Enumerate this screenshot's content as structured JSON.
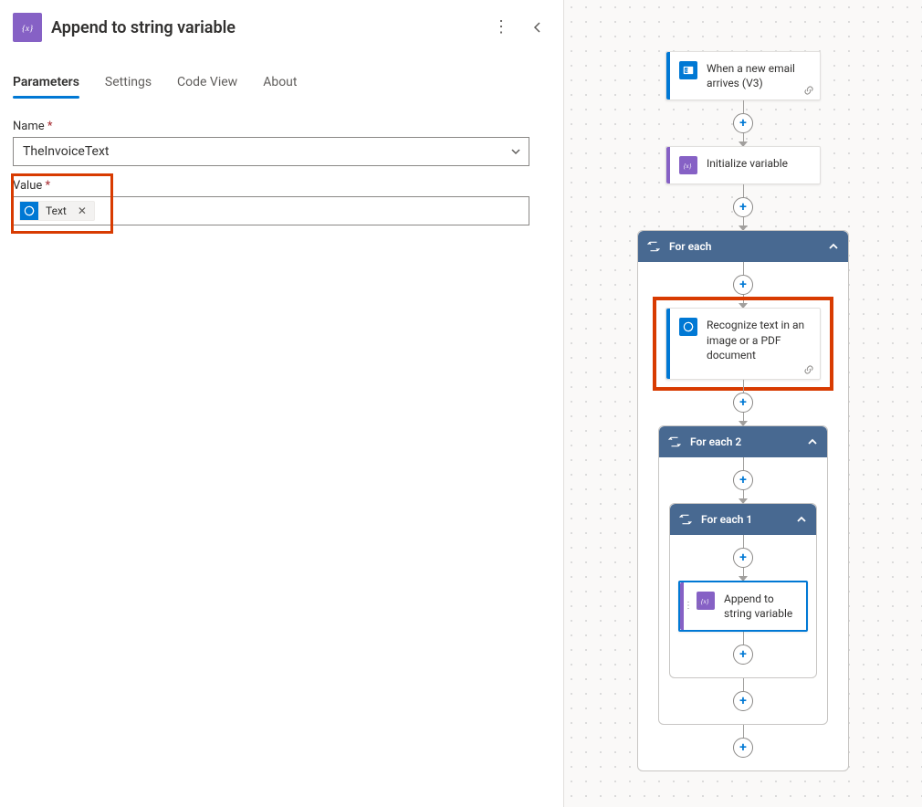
{
  "panel": {
    "title": "Append to string variable",
    "tabs": {
      "parameters": "Parameters",
      "settings": "Settings",
      "code_view": "Code View",
      "about": "About"
    },
    "fields": {
      "name_label": "Name",
      "name_value": "TheInvoiceText",
      "value_label": "Value"
    },
    "token": {
      "label": "Text",
      "icon": "cognitive-services-icon"
    }
  },
  "flow": {
    "email_card": "When a new email arrives (V3)",
    "init_var_card": "Initialize variable",
    "for_each": "For each",
    "recognize_card": "Recognize text in an image or a PDF document",
    "for_each_2": "For each 2",
    "for_each_1": "For each 1",
    "append_card": "Append to string variable"
  }
}
